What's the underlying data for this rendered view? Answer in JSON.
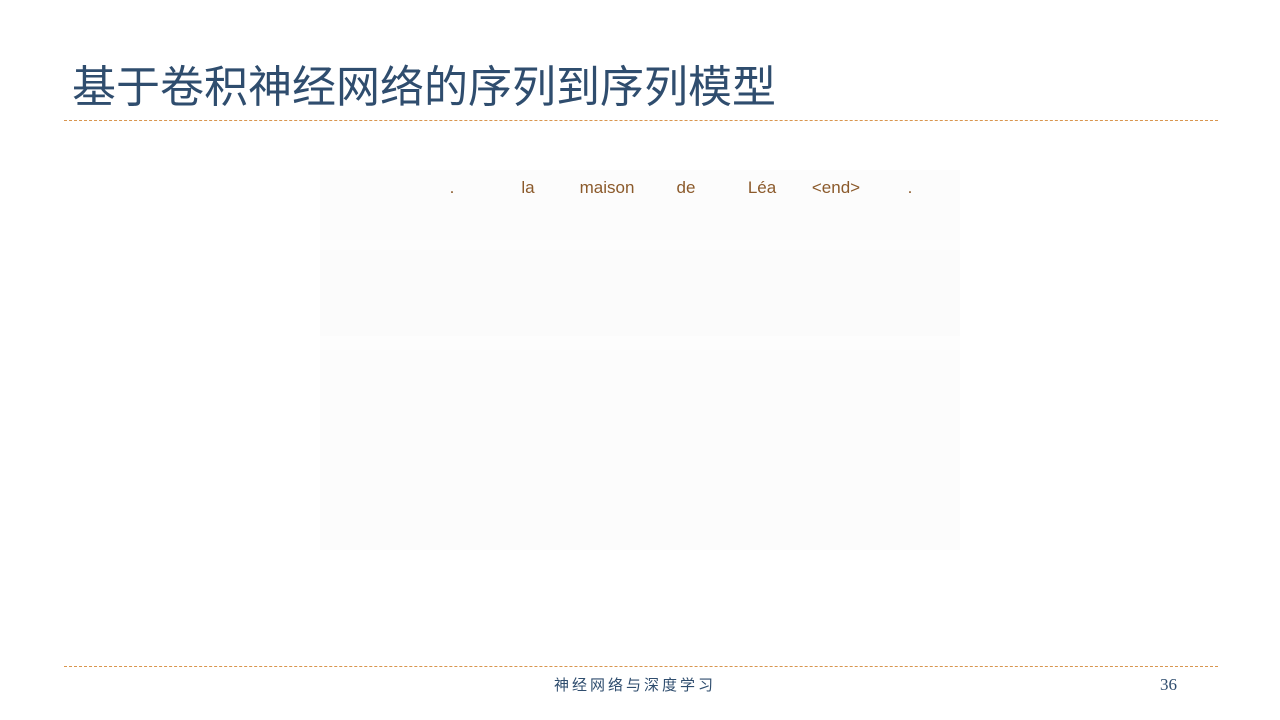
{
  "slide": {
    "title": "基于卷积神经网络的序列到序列模型",
    "figure": {
      "output_tokens": [
        ".",
        "la",
        "maison",
        "de",
        "Léa",
        "<end>",
        "."
      ]
    },
    "footer": {
      "text": "神经网络与深度学习",
      "page_number": "36"
    },
    "colors": {
      "title": "#2f4d6e",
      "rule": "#d9964f",
      "token": "#8b5a2b"
    }
  }
}
